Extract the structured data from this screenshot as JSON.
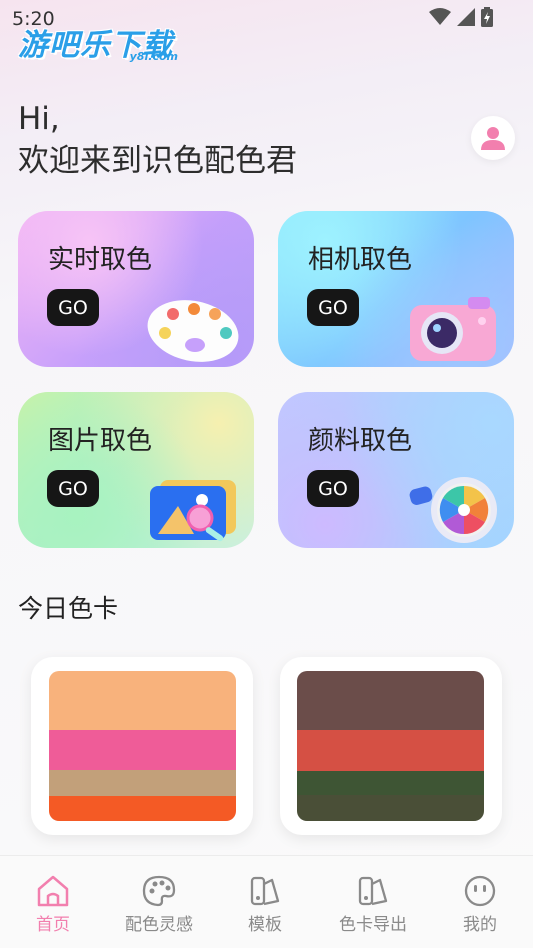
{
  "status_bar": {
    "time": "5:20"
  },
  "watermark": {
    "text": "游吧乐下载",
    "sub": "y8l.com"
  },
  "greeting": {
    "line1": "Hi,",
    "line2": "欢迎来到识色配色君"
  },
  "cards": [
    {
      "title": "实时取色",
      "go": "GO",
      "icon": "palette-icon"
    },
    {
      "title": "相机取色",
      "go": "GO",
      "icon": "camera-icon"
    },
    {
      "title": "图片取色",
      "go": "GO",
      "icon": "image-icon"
    },
    {
      "title": "颜料取色",
      "go": "GO",
      "icon": "color-wheel-icon"
    }
  ],
  "today": {
    "title": "今日色卡",
    "swatches": [
      {
        "colors": [
          "#f8b27c",
          "#ef5c98",
          "#c2a07a",
          "#f45a25"
        ]
      },
      {
        "colors": [
          "#6b4d4a",
          "#d55044",
          "#3e5534",
          "#4a4f37"
        ]
      }
    ]
  },
  "tabbar": {
    "items": [
      {
        "label": "首页",
        "icon": "home-icon",
        "active": true
      },
      {
        "label": "配色灵感",
        "icon": "palette-icon",
        "active": false
      },
      {
        "label": "模板",
        "icon": "template-icon",
        "active": false
      },
      {
        "label": "色卡导出",
        "icon": "swatch-export-icon",
        "active": false
      },
      {
        "label": "我的",
        "icon": "smiley-icon",
        "active": false
      }
    ]
  },
  "colors": {
    "accent": "#f27fae",
    "go_button": "#161616"
  }
}
